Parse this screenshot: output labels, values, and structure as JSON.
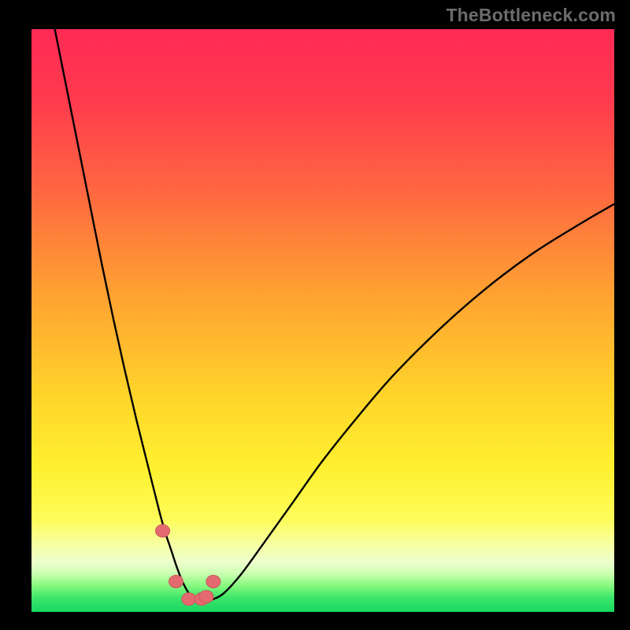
{
  "watermark": "TheBottleneck.com",
  "colors": {
    "frame": "#000000",
    "curve": "#000000",
    "marker_fill": "#e46a6f",
    "marker_stroke": "#c9585d",
    "gradient_stops": [
      {
        "offset": 0.0,
        "color": "#ff2a55"
      },
      {
        "offset": 0.12,
        "color": "#ff3a4e"
      },
      {
        "offset": 0.28,
        "color": "#ff6840"
      },
      {
        "offset": 0.45,
        "color": "#ffa032"
      },
      {
        "offset": 0.62,
        "color": "#ffd22a"
      },
      {
        "offset": 0.75,
        "color": "#fff02f"
      },
      {
        "offset": 0.84,
        "color": "#fdfc58"
      },
      {
        "offset": 0.885,
        "color": "#f6ffa4"
      },
      {
        "offset": 0.915,
        "color": "#edffce"
      },
      {
        "offset": 0.935,
        "color": "#c9ffb0"
      },
      {
        "offset": 0.955,
        "color": "#87f97f"
      },
      {
        "offset": 0.975,
        "color": "#3ee66a"
      },
      {
        "offset": 1.0,
        "color": "#17d862"
      }
    ]
  },
  "chart_data": {
    "type": "line",
    "title": "",
    "xlabel": "",
    "ylabel": "",
    "xlim": [
      0,
      100
    ],
    "ylim": [
      0,
      100
    ],
    "series": [
      {
        "name": "bottleneck-curve",
        "x": [
          4,
          6,
          8,
          10,
          12,
          14,
          16,
          18,
          20,
          22,
          23,
          24,
          25,
          26,
          27,
          28,
          29,
          30,
          31,
          33,
          36,
          40,
          45,
          50,
          56,
          62,
          70,
          78,
          86,
          94,
          100
        ],
        "values": [
          100,
          90,
          80,
          70,
          60,
          50.5,
          41.5,
          33,
          25,
          17,
          13.5,
          10.5,
          7.5,
          5,
          3.2,
          2.2,
          1.8,
          1.8,
          2.1,
          3.2,
          6.5,
          12,
          19,
          26,
          33.5,
          40.5,
          48.5,
          55.5,
          61.5,
          66.5,
          70
        ]
      }
    ],
    "markers": {
      "name": "highlight-points",
      "x": [
        22.5,
        24.8,
        27.0,
        29.2,
        30.0,
        31.2
      ],
      "values": [
        13.9,
        5.2,
        2.2,
        2.2,
        2.6,
        5.2
      ]
    }
  }
}
